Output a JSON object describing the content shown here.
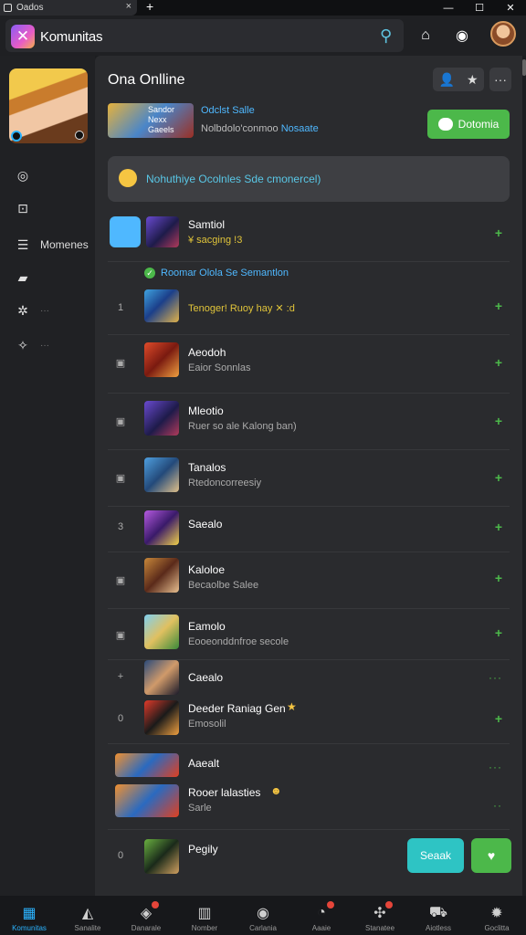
{
  "os": {
    "tab_title": "Oados",
    "close": "×",
    "new_tab": "+"
  },
  "header": {
    "title": "Komunitas",
    "logo_glyph": "✕"
  },
  "rail": {
    "items": [
      {
        "label": "",
        "icon": "compass-icon"
      },
      {
        "label": "",
        "icon": "frame-icon"
      },
      {
        "label": "Momenes",
        "icon": "list-icon"
      },
      {
        "label": "",
        "icon": "folder-icon"
      },
      {
        "label": "···",
        "icon": "gear-icon"
      },
      {
        "label": "···",
        "icon": "settings-icon"
      }
    ]
  },
  "panel": {
    "title": "Ona Onlline",
    "hero": {
      "thumb_text": "Sandor Nexx Gaeels",
      "name": "Odclst Salle",
      "desc": "Nolbdolo'conmoo",
      "desc_hl": "Nosaate",
      "button": "Dotomia"
    },
    "notice": "Nohuthiye Ocolnles Sde cmonercel)",
    "rows": [
      {
        "num": "",
        "title": "Samtiol",
        "sub": "¥ sacging !3",
        "sub_yellow": true,
        "action": "+"
      },
      {
        "num": "1",
        "title": "",
        "sub": "Tenoger! Ruoy hay  ✕ :d",
        "sub_yellow": true,
        "action": "+"
      },
      {
        "num": "▣",
        "title": "Aeodoh",
        "sub": "Eaior Sonnlas",
        "sub_yellow": false,
        "action": "+"
      },
      {
        "num": "▣",
        "title": "Mleotio",
        "sub": "Ruer so ale Kalong ban)",
        "sub_yellow": false,
        "action": "+"
      },
      {
        "num": "▣",
        "title": "Tanalos",
        "sub": "Rtedoncorreesiy",
        "sub_yellow": false,
        "action": "+"
      },
      {
        "num": "3",
        "title": "Saealo",
        "sub": "",
        "sub_yellow": false,
        "action": "+"
      },
      {
        "num": "▣",
        "title": "Kaloloe",
        "sub": "Becaolbe Salee",
        "sub_yellow": false,
        "action": "+"
      },
      {
        "num": "▣",
        "title": "Eamolo",
        "sub": "Eooeonddnfroe secole",
        "sub_yellow": false,
        "action": "+"
      },
      {
        "num": "+",
        "title": "Caealo",
        "sub": "",
        "sub_yellow": false,
        "action": "···"
      },
      {
        "num": "0",
        "title": "Deeder Raniag Gen",
        "sub": "Emosolil",
        "sub_yellow": false,
        "action": "+"
      },
      {
        "num": "",
        "title": "Aaealt",
        "sub": "",
        "sub_yellow": false,
        "action": "···"
      },
      {
        "num": "",
        "title": "Rooer lalasties",
        "sub": "Sarle",
        "sub_yellow": false,
        "action": "··"
      },
      {
        "num": "0",
        "title": "Pegily",
        "sub": "",
        "sub_yellow": false,
        "action": ""
      }
    ],
    "section_label": "Roomar Olola Se Semantlon",
    "teal_button": "Seaak",
    "green_button": "♥"
  },
  "bottom_nav": [
    {
      "label": "Komunitas",
      "icon": "home-icon",
      "active": true,
      "badge": false
    },
    {
      "label": "Sanalite",
      "icon": "mountain-icon",
      "active": false,
      "badge": false
    },
    {
      "label": "Danarale",
      "icon": "shield-icon",
      "active": false,
      "badge": true
    },
    {
      "label": "Nomber",
      "icon": "building-icon",
      "active": false,
      "badge": false
    },
    {
      "label": "Carlania",
      "icon": "disc-icon",
      "active": false,
      "badge": false
    },
    {
      "label": "Aaaie",
      "icon": "clock-icon",
      "active": false,
      "badge": true
    },
    {
      "label": "Stanatee",
      "icon": "globe-icon",
      "active": false,
      "badge": true
    },
    {
      "label": "Aiotless",
      "icon": "car-icon",
      "active": false,
      "badge": false
    },
    {
      "label": "Goclitta",
      "icon": "gear-icon",
      "active": false,
      "badge": false
    }
  ]
}
